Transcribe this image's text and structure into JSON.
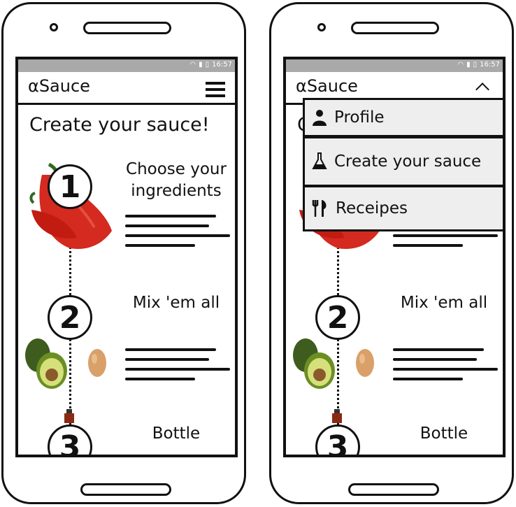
{
  "status": {
    "time": "16:57"
  },
  "app": {
    "title": "αSauce"
  },
  "page": {
    "heading": "Create your sauce!"
  },
  "steps": [
    {
      "number": "1",
      "title": "Choose your ingredients"
    },
    {
      "number": "2",
      "title": "Mix 'em all"
    },
    {
      "number": "3",
      "title": "Bottle"
    }
  ],
  "menu": {
    "items": [
      {
        "label": "Profile",
        "icon": "person-icon"
      },
      {
        "label": "Create your sauce",
        "icon": "flask-icon"
      },
      {
        "label": "Receipes",
        "icon": "fork-knife-icon"
      }
    ]
  },
  "colors": {
    "statusbar": "#a9a9a9",
    "menu_bg": "#eeeeee",
    "pepper": "#d42a1f",
    "avocado": "#6b8e23"
  }
}
